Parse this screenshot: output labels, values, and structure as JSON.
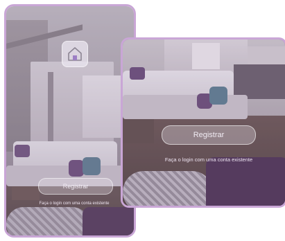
{
  "colors": {
    "frame_border": "#c9a6d6",
    "button_text": "#f1ecf4",
    "overlay_tint": "#aa96b4"
  },
  "phone": {
    "logo_icon": "house-icon",
    "register_label": "Registrar",
    "login_hint": "Faça o login com uma conta existente"
  },
  "tablet": {
    "register_label": "Registrar",
    "login_hint": "Faça o login com uma conta existente"
  }
}
